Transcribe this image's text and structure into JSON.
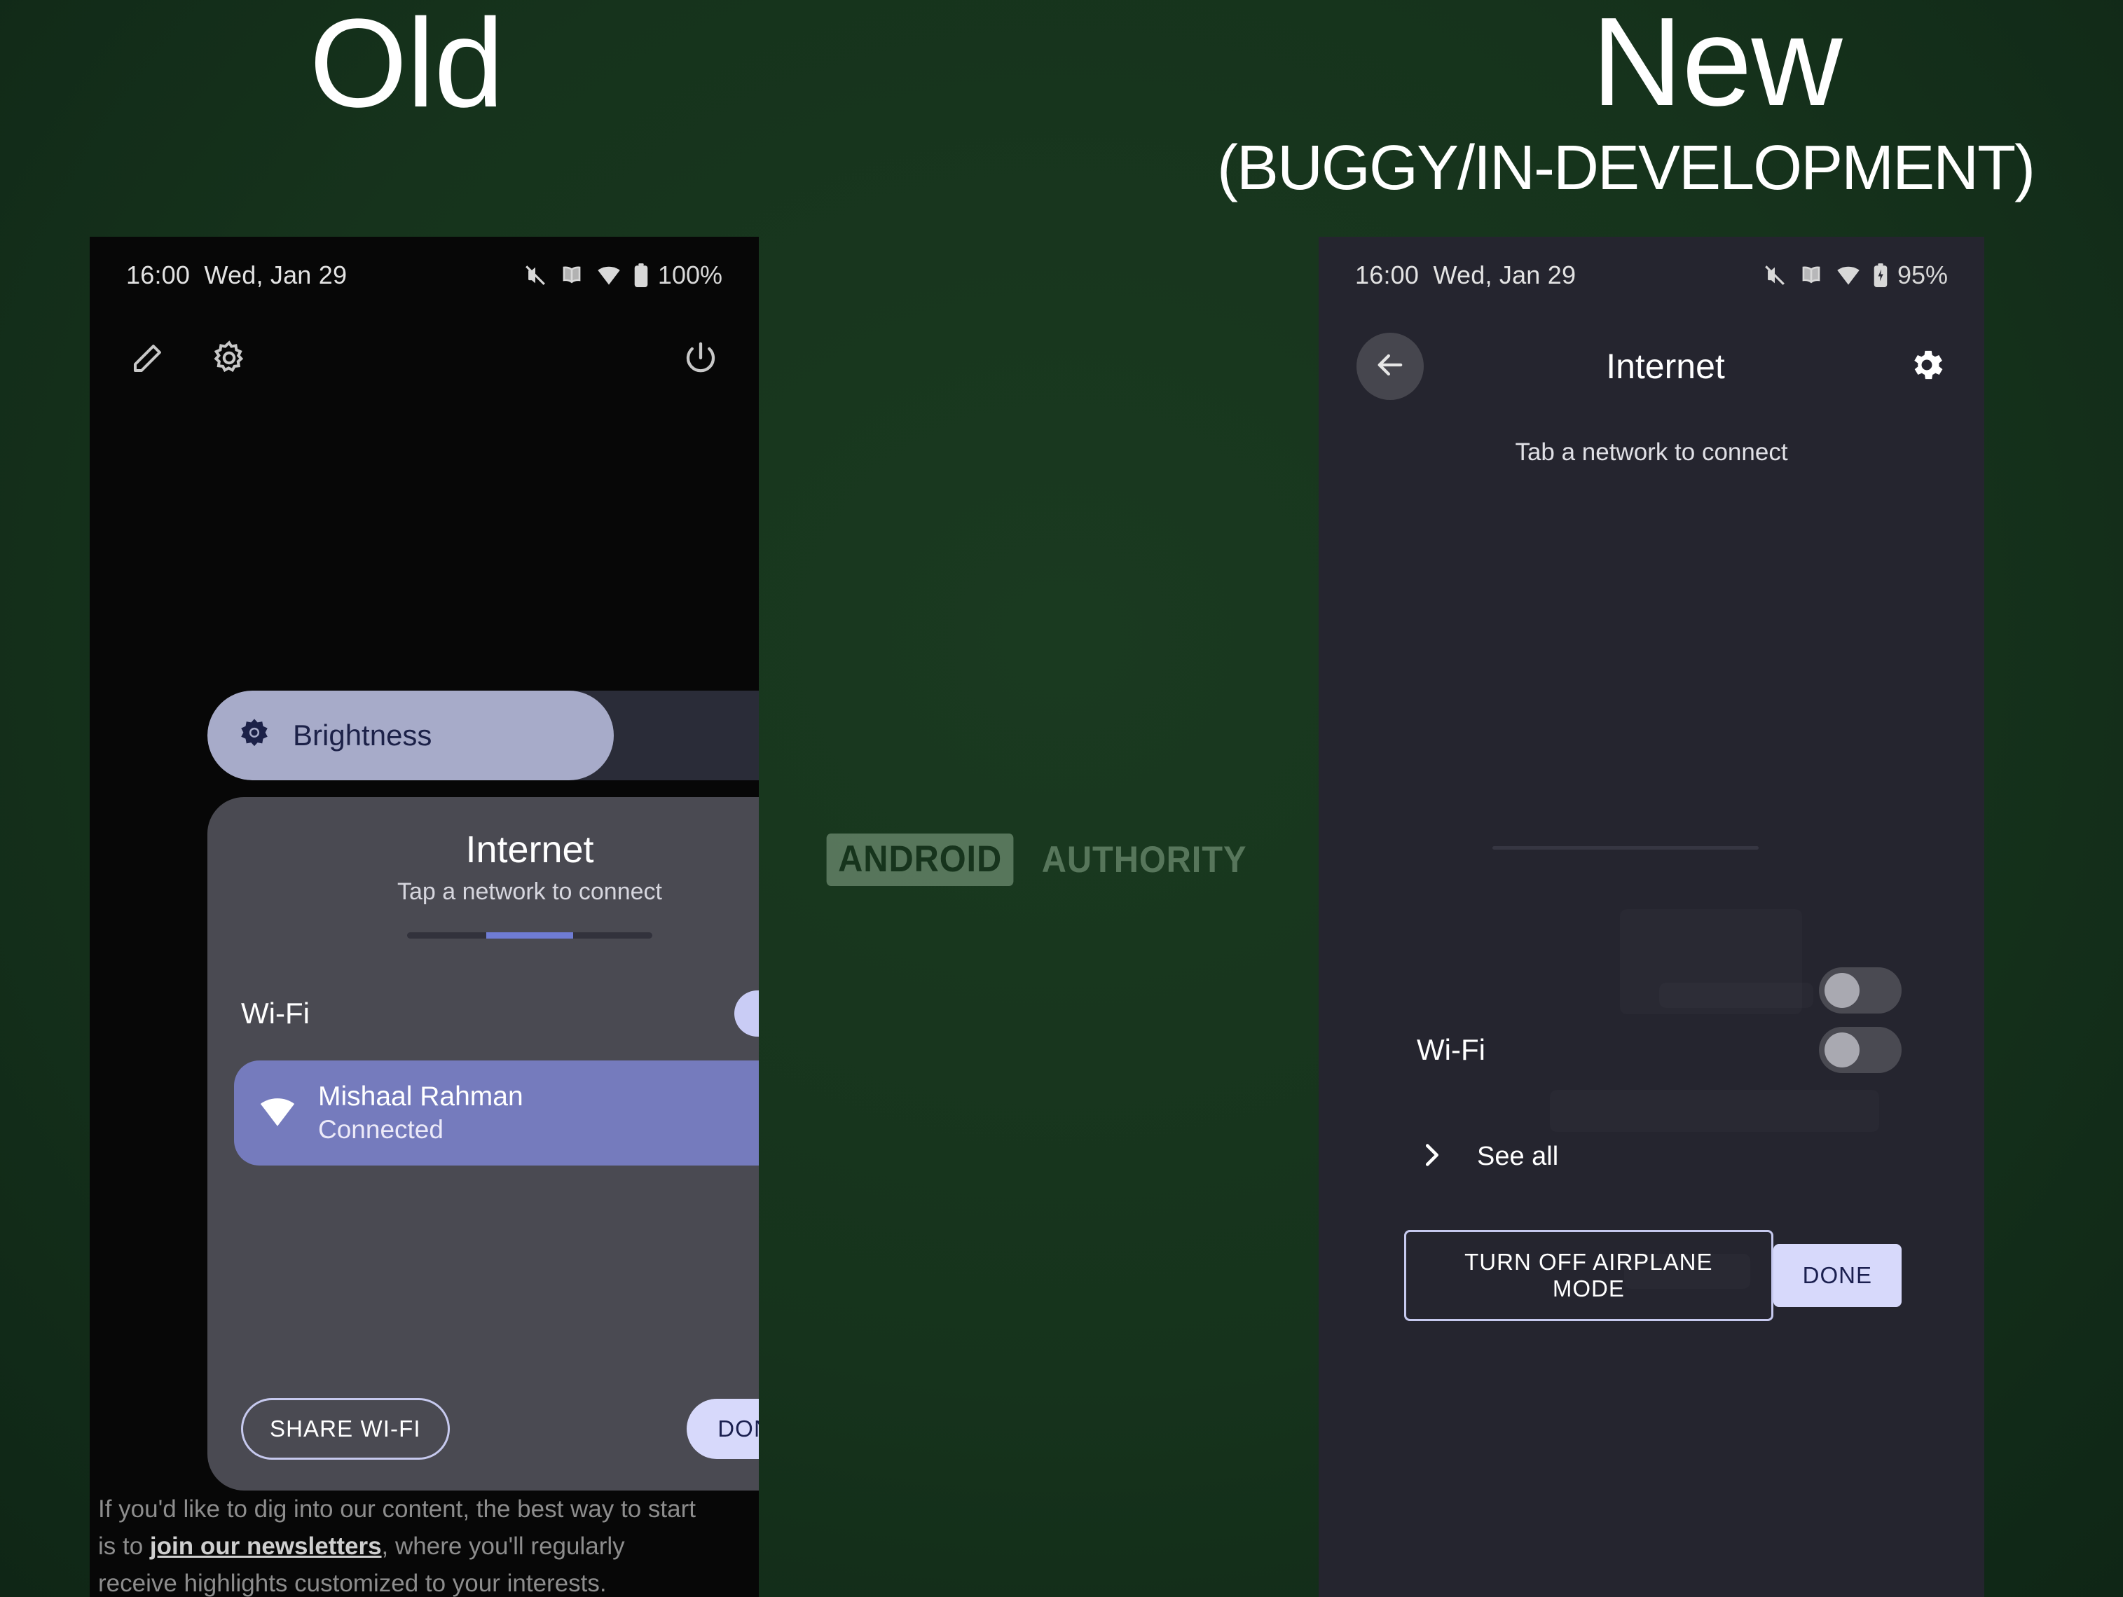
{
  "background_color": "#16331c",
  "headings": {
    "old": "Old",
    "new": "New",
    "new_subtitle": "(BUGGY/IN-DEVELOPMENT)"
  },
  "watermark": {
    "box_text": "ANDROID",
    "text": "AUTHORITY",
    "box_color": "#7e9c81",
    "text_color": "#7e9c81"
  },
  "old_phone": {
    "statusbar": {
      "time": "16:00",
      "date": "Wed, Jan 29",
      "battery_percent": "100%",
      "icons": [
        "mute-icon",
        "book-icon",
        "wifi-icon",
        "battery-icon"
      ]
    },
    "quick_settings": {
      "icons": [
        "pencil-icon",
        "gear-icon",
        "power-icon"
      ]
    },
    "brightness": {
      "label": "Brightness",
      "level_percent": 63,
      "icon": "brightness-icon",
      "fill_color": "#a7abc9",
      "track_color": "#2a2c38"
    },
    "internet_sheet": {
      "title": "Internet",
      "subtitle": "Tap a network to connect",
      "page_indicator": {
        "segments": 3,
        "active_index": 1,
        "active_color": "#6f7cd4"
      },
      "wifi_row": {
        "label": "Wi-Fi",
        "toggle_state": "on"
      },
      "network": {
        "name": "Mishaal Rahman",
        "status": "Connected",
        "icon": "wifi-icon",
        "settings_icon": "gear-icon",
        "card_color": "#757bbd"
      },
      "actions": {
        "secondary": "SHARE WI-FI",
        "primary": "DONE"
      }
    },
    "newsletter": {
      "part1": "If you'd like to dig into our content, the best way to start is to ",
      "link": "join our newsletters",
      "part2": ", where you'll regularly receive highlights customized to your interests."
    }
  },
  "new_phone": {
    "statusbar": {
      "time": "16:00",
      "date": "Wed, Jan 29",
      "battery_percent": "95%",
      "icons": [
        "mute-icon",
        "book-icon",
        "wifi-icon",
        "battery-charging-icon"
      ]
    },
    "appbar": {
      "back_icon": "arrow-left-icon",
      "title": "Internet",
      "settings_icon": "gear-icon"
    },
    "subtitle": "Tab a network to connect",
    "orphan_toggle_state": "off",
    "wifi_row": {
      "label": "Wi-Fi",
      "toggle_state": "off"
    },
    "see_all": {
      "label": "See all",
      "icon": "chevron-right-icon"
    },
    "actions": {
      "secondary": "TURN OFF AIRPLANE MODE",
      "primary": "DONE"
    }
  }
}
